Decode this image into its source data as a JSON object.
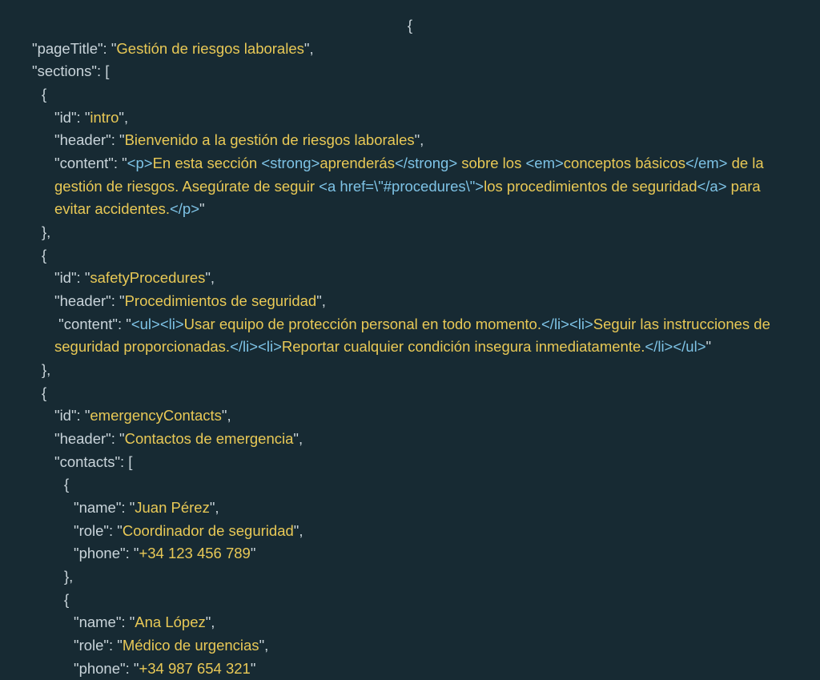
{
  "lines": {
    "l0": "{",
    "l1_key": "\"pageTitle\": \"",
    "l1_str": "Gestión de riesgos laborales",
    "l1_end": "\",",
    "l2": "\"sections\": [",
    "l3": "{",
    "l4_key": "\"id\": \"",
    "l4_str": "intro",
    "l4_end": "\",",
    "l5_key": "\"header\": \"",
    "l5_str": "Bienvenido a la gestión de riesgos laborales",
    "l5_end": "\",",
    "l6_key": "\"content\": \"",
    "l6_t1": "<p>",
    "l6_s1": "En esta sección ",
    "l6_t2": "<strong>",
    "l6_s2": "aprenderás",
    "l6_t3": "</strong>",
    "l6_s3": " sobre los ",
    "l6_t4": "<em>",
    "l6_s4": "conceptos básicos",
    "l6_t5": "</em>",
    "l6_s5": " de la gestión de riesgos. Asegúrate de seguir ",
    "l6_t6": "<a href=\\\"#procedures\\\">",
    "l6_s6": "los procedimientos de seguridad",
    "l6_t7": "</a>",
    "l6_s7": " para evitar accidentes.",
    "l6_t8": "</p>",
    "l6_end": "\"",
    "l7": "},",
    "l8": "{",
    "l9_key": "\"id\": \"",
    "l9_str": "safetyProcedures",
    "l9_end": "\",",
    "l10_key": "\"header\": \"",
    "l10_str": "Procedimientos de seguridad",
    "l10_end": "\",",
    "l11_key": " \"content\": \"",
    "l11_t1": "<ul><li>",
    "l11_s1": "Usar equipo de protección personal en todo momento.",
    "l11_t2": "</li><li>",
    "l11_s2": "Seguir las instrucciones de seguridad proporcionadas.",
    "l11_t3": "</li><li>",
    "l11_s3": "Reportar cualquier condición insegura inmediatamente.",
    "l11_t4": "</li></ul>",
    "l11_end": "\"",
    "l12": "},",
    "l13": "{",
    "l14_key": "\"id\": \"",
    "l14_str": "emergencyContacts",
    "l14_end": "\",",
    "l15_key": "\"header\": \"",
    "l15_str": "Contactos de emergencia",
    "l15_end": "\",",
    "l16": "\"contacts\": [",
    "l17": "{",
    "l18_key": "\"name\": \"",
    "l18_str": "Juan Pérez",
    "l18_end": "\",",
    "l19_key": "\"role\": \"",
    "l19_str": "Coordinador de seguridad",
    "l19_end": "\",",
    "l20_key": "\"phone\": \"",
    "l20_str": "+34 123 456 789",
    "l20_end": "\"",
    "l21": "},",
    "l22": "{",
    "l23_key": "\"name\": \"",
    "l23_str": "Ana López",
    "l23_end": "\",",
    "l24_key": "\"role\": \"",
    "l24_str": "Médico de urgencias",
    "l24_end": "\",",
    "l25_key": "\"phone\": \"",
    "l25_str": "+34 987 654 321",
    "l25_end": "\""
  }
}
